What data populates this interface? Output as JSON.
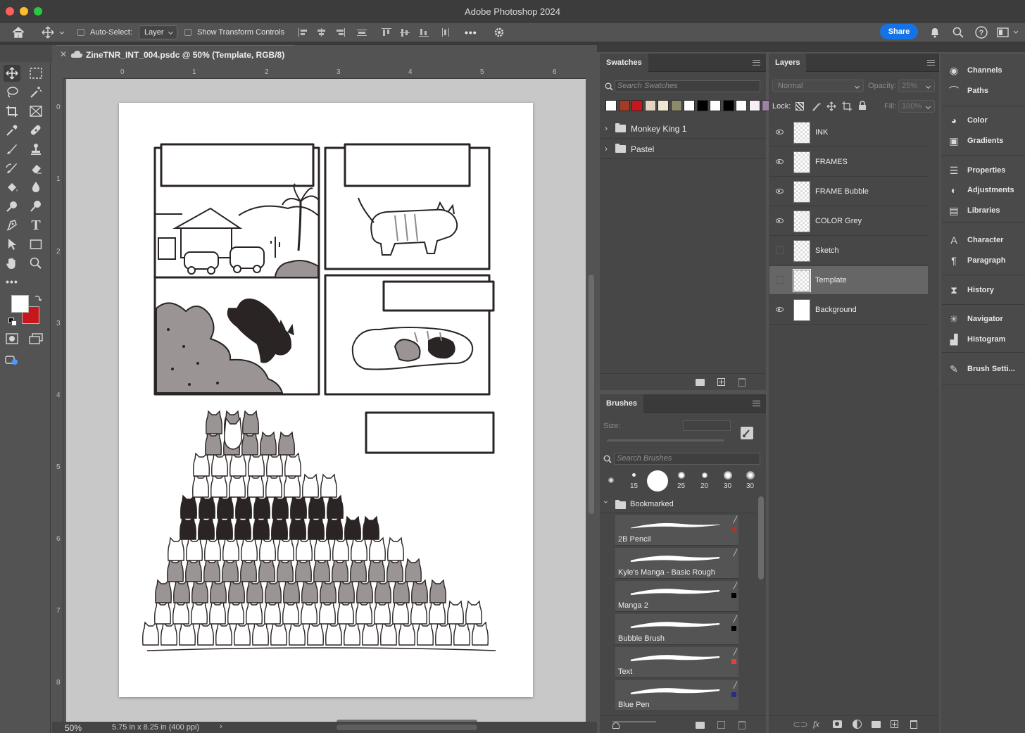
{
  "app": {
    "title": "Adobe Photoshop 2024"
  },
  "colors": {
    "accent": "#1473e6",
    "foreground_swatch": "#ffffff",
    "background_swatch": "#c8161d"
  },
  "options_bar": {
    "auto_select_label": "Auto-Select:",
    "auto_select_target": "Layer",
    "show_transform_label": "Show Transform Controls",
    "more_label": "•••",
    "share_label": "Share"
  },
  "document": {
    "tab_label": "ZineTNR_INT_004.psdc @ 50% (Template, RGB/8)",
    "zoom": "50%",
    "size_info": "5.75 in x 8.25 in (400 ppi)",
    "ruler_top": [
      "0",
      "1",
      "2",
      "3",
      "4",
      "5",
      "6"
    ],
    "ruler_left": [
      "0",
      "1",
      "2",
      "3",
      "4",
      "5",
      "6",
      "7",
      "8"
    ]
  },
  "swatches_panel": {
    "title": "Swatches",
    "search_placeholder": "Search Swatches",
    "colors": [
      "#ffffff",
      "#a23c23",
      "#c8161d",
      "#e2d6c3",
      "#efe6d2",
      "#8e8a6c",
      "#ffffff",
      "#000000",
      "#ffffff",
      "#000000",
      "#ffffff",
      "#f6eef5",
      "#9c83a3"
    ],
    "groups": [
      {
        "name": "Monkey King 1"
      },
      {
        "name": "Pastel"
      }
    ]
  },
  "brushes_panel": {
    "title": "Brushes",
    "size_label": "Size:",
    "search_placeholder": "Search Brushes",
    "presets": [
      "15",
      "25",
      "20",
      "30",
      "30"
    ],
    "group_name": "Bookmarked",
    "items": [
      {
        "name": "2B Pencil",
        "swatch": "#a3372a"
      },
      {
        "name": "Kyle's Manga - Basic Rough",
        "swatch": ""
      },
      {
        "name": "Manga 2",
        "swatch": "#000000"
      },
      {
        "name": "Bubble Brush",
        "swatch": "#000000"
      },
      {
        "name": "Text",
        "swatch": "#e0413a"
      },
      {
        "name": "Blue Pen",
        "swatch": "#2c2c80"
      }
    ]
  },
  "layers_panel": {
    "title": "Layers",
    "blend_mode": "Normal",
    "opacity_label": "Opacity:",
    "opacity_value": "25%",
    "lock_label": "Lock:",
    "fill_label": "Fill:",
    "fill_value": "100%",
    "layers": [
      {
        "name": "INK",
        "visible": true,
        "selected": false
      },
      {
        "name": "FRAMES",
        "visible": true,
        "selected": false
      },
      {
        "name": "FRAME Bubble",
        "visible": true,
        "selected": false
      },
      {
        "name": "COLOR Grey",
        "visible": true,
        "selected": false
      },
      {
        "name": "Sketch",
        "visible": false,
        "selected": false
      },
      {
        "name": "Template",
        "visible": false,
        "selected": true
      },
      {
        "name": "Background",
        "visible": true,
        "selected": false
      }
    ]
  },
  "right_dock": {
    "items": [
      {
        "label": "Channels",
        "icon": "channels-icon"
      },
      {
        "label": "Paths",
        "icon": "paths-icon"
      },
      {
        "label": "Color",
        "icon": "palette-icon"
      },
      {
        "label": "Gradients",
        "icon": "gradient-icon"
      },
      {
        "label": "Properties",
        "icon": "sliders-icon"
      },
      {
        "label": "Adjustments",
        "icon": "adjustments-icon"
      },
      {
        "label": "Libraries",
        "icon": "libraries-icon"
      },
      {
        "label": "Character",
        "icon": "character-icon"
      },
      {
        "label": "Paragraph",
        "icon": "paragraph-icon"
      },
      {
        "label": "History",
        "icon": "history-icon"
      },
      {
        "label": "Navigator",
        "icon": "navigator-icon"
      },
      {
        "label": "Histogram",
        "icon": "histogram-icon"
      },
      {
        "label": "Brush Setti...",
        "icon": "brush-settings-icon"
      }
    ]
  }
}
